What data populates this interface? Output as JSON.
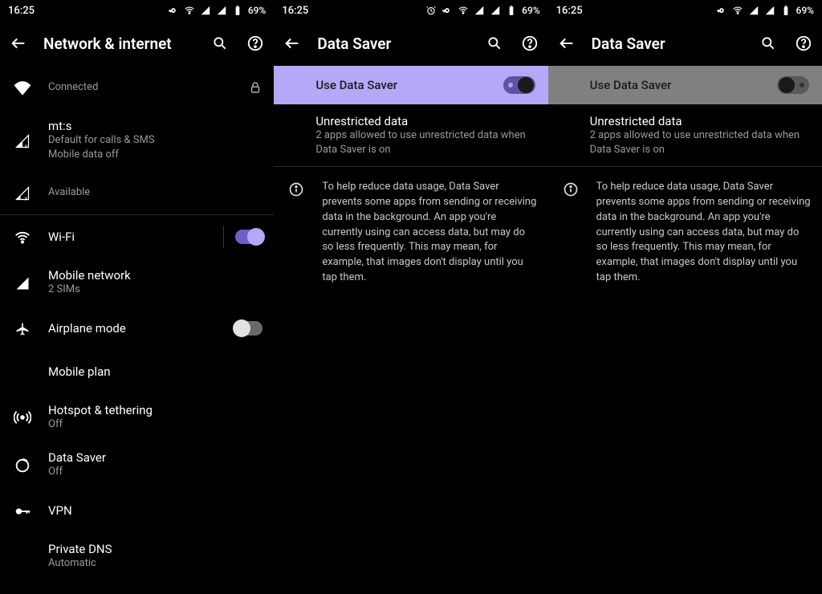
{
  "status": {
    "time": "16:25",
    "battery": "69%"
  },
  "screen1": {
    "title": "Network & internet",
    "items": {
      "connected": {
        "sub": "Connected"
      },
      "mts": {
        "title": "mt:s",
        "sub1": "Default for calls & SMS",
        "sub2": "Mobile data off"
      },
      "available": {
        "sub": "Available"
      },
      "wifi": {
        "title": "Wi-Fi"
      },
      "mobilenet": {
        "title": "Mobile network",
        "sub": "2 SIMs"
      },
      "airplane": {
        "title": "Airplane mode"
      },
      "mobileplan": {
        "title": "Mobile plan"
      },
      "hotspot": {
        "title": "Hotspot & tethering",
        "sub": "Off"
      },
      "datasaver": {
        "title": "Data Saver",
        "sub": "Off"
      },
      "vpn": {
        "title": "VPN"
      },
      "privatedns": {
        "title": "Private DNS",
        "sub": "Automatic"
      }
    }
  },
  "ds": {
    "title": "Data Saver",
    "hero": "Use Data Saver",
    "unrestricted": {
      "title": "Unrestricted data",
      "sub": "2 apps allowed to use unrestricted data when Data Saver is on"
    },
    "info": "To help reduce data usage, Data Saver prevents some apps from sending or receiving data in the background. An app you're currently using can access data, but may do so less frequently. This may mean, for example, that images don't display until you tap them."
  }
}
